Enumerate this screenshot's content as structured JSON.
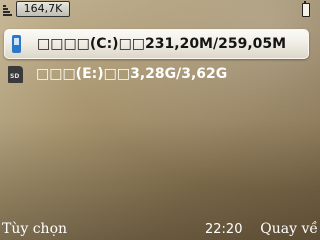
{
  "status_bar": {
    "memory_free": "164,7K"
  },
  "drives": [
    {
      "label": "□□□□(C:)□□231,20M/259,05M",
      "icon": "phone-memory-icon",
      "selected": true
    },
    {
      "label": "□□□(E:)□□3,28G/3,62G",
      "icon": "memory-card-icon",
      "selected": false
    }
  ],
  "softkeys": {
    "left": "Tùy chọn",
    "right": "Quay về"
  },
  "clock": "22:20",
  "colors": {
    "selection_highlight": "#f1eee6",
    "phone_icon": "#2a78c8",
    "wallpaper": "#a8956f"
  }
}
